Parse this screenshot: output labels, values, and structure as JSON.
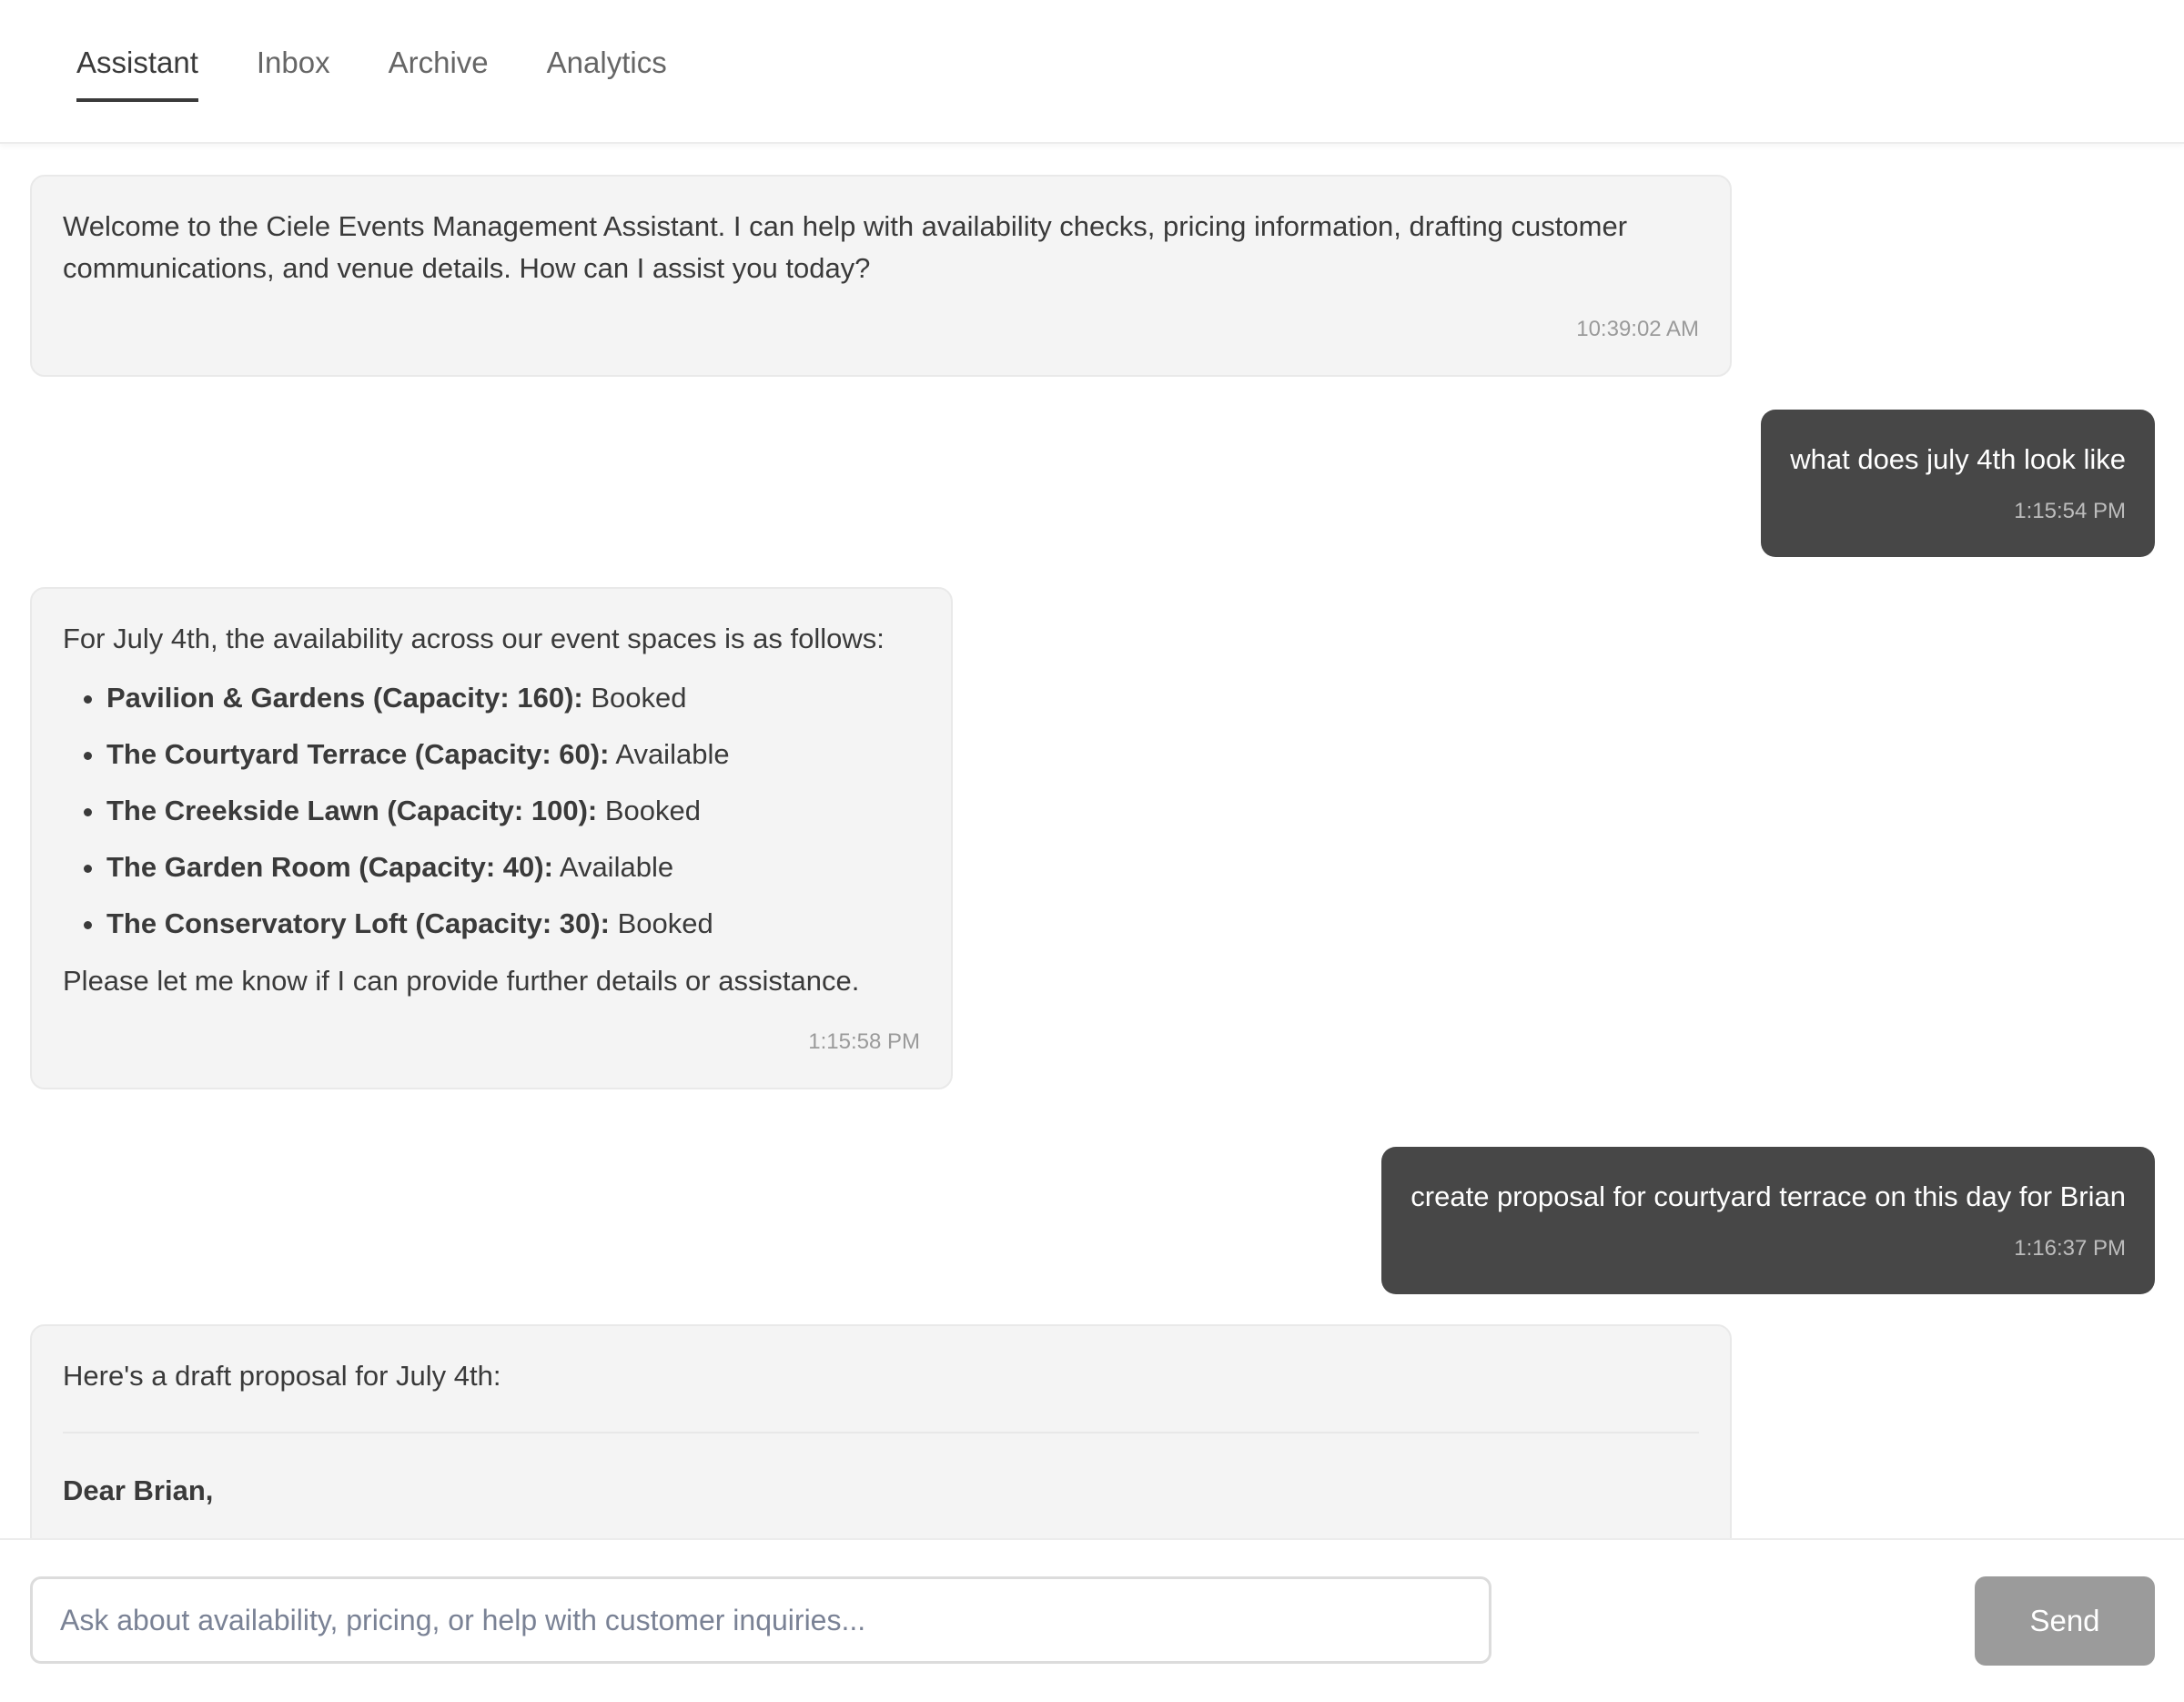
{
  "tabs": [
    {
      "label": "Assistant",
      "active": true
    },
    {
      "label": "Inbox",
      "active": false
    },
    {
      "label": "Archive",
      "active": false
    },
    {
      "label": "Analytics",
      "active": false
    }
  ],
  "messages": {
    "welcome": {
      "text": "Welcome to the Ciele Events Management Assistant. I can help with availability checks, pricing information, drafting customer communications, and venue details. How can I assist you today?",
      "time": "10:39:02 AM"
    },
    "user1": {
      "text": "what does july 4th look like",
      "time": "1:15:54 PM"
    },
    "availability": {
      "intro": "For July 4th, the availability across our event spaces is as follows:",
      "venues": [
        {
          "name": "Pavilion & Gardens (Capacity: 160):",
          "status": "Booked"
        },
        {
          "name": "The Courtyard Terrace (Capacity: 60):",
          "status": "Available"
        },
        {
          "name": "The Creekside Lawn (Capacity: 100):",
          "status": "Booked"
        },
        {
          "name": "The Garden Room (Capacity: 40):",
          "status": "Available"
        },
        {
          "name": "The Conservatory Loft (Capacity: 30):",
          "status": "Booked"
        }
      ],
      "outro": "Please let me know if I can provide further details or assistance.",
      "time": "1:15:58 PM"
    },
    "user2": {
      "text": "create proposal for courtyard terrace on this day for Brian",
      "time": "1:16:37 PM"
    },
    "proposal": {
      "intro": "Here's a draft proposal for July 4th:",
      "greeting": "Dear Brian,"
    }
  },
  "composer": {
    "placeholder": "Ask about availability, pricing, or help with customer inquiries...",
    "send_label": "Send"
  }
}
